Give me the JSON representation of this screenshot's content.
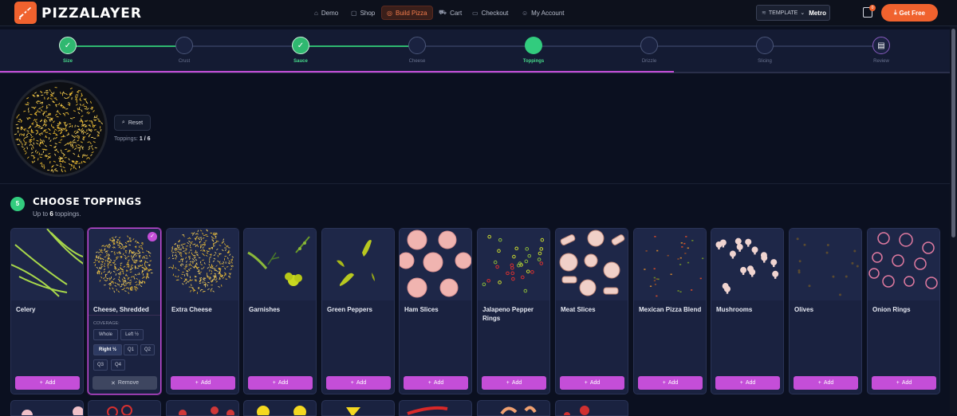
{
  "brand": {
    "name": "PIZZALAYER"
  },
  "nav": [
    {
      "label": "Demo",
      "icon": "home-icon"
    },
    {
      "label": "Shop",
      "icon": "bag-icon"
    },
    {
      "label": "Build Pizza",
      "icon": "target-icon",
      "active": true
    },
    {
      "label": "Cart",
      "icon": "cart-icon"
    },
    {
      "label": "Checkout",
      "icon": "card-icon"
    },
    {
      "label": "My Account",
      "icon": "user-icon"
    }
  ],
  "template": {
    "label": "TEMPLATE",
    "value": "Metro"
  },
  "cart_count": "0",
  "get_free": "Get Free",
  "steps": [
    {
      "label": "Size",
      "state": "done"
    },
    {
      "label": "Crust",
      "state": "todo"
    },
    {
      "label": "Sauce",
      "state": "done"
    },
    {
      "label": "Cheese",
      "state": "todo"
    },
    {
      "label": "Toppings",
      "state": "current"
    },
    {
      "label": "Drizzle",
      "state": "todo"
    },
    {
      "label": "Slicing",
      "state": "todo"
    },
    {
      "label": "Review",
      "state": "todo"
    }
  ],
  "preview": {
    "reset": "Reset",
    "count_label": "Toppings:",
    "count_value": "1 / 6"
  },
  "section": {
    "number": "5",
    "title": "CHOOSE TOPPINGS",
    "sub_prefix": "Up to",
    "sub_count": "6",
    "sub_suffix": "toppings."
  },
  "toppings": [
    {
      "name": "Celery"
    },
    {
      "name": "Cheese, Shredded",
      "selected": true
    },
    {
      "name": "Extra Cheese"
    },
    {
      "name": "Garnishes"
    },
    {
      "name": "Green Peppers"
    },
    {
      "name": "Ham Slices"
    },
    {
      "name": "Jalapeno Pepper Rings"
    },
    {
      "name": "Meat Slices"
    },
    {
      "name": "Mexican Pizza Blend"
    },
    {
      "name": "Mushrooms"
    },
    {
      "name": "Olives"
    },
    {
      "name": "Onion Rings"
    }
  ],
  "add_label": "Add",
  "coverage": {
    "label": "COVERAGE:",
    "options": [
      "Whole",
      "Left ½",
      "Right ½",
      "Q1",
      "Q2",
      "Q3",
      "Q4"
    ],
    "selected": "Right ½"
  },
  "remove_label": "Remove",
  "colors": {
    "accent": "#c44ed8",
    "brand": "#f0622e",
    "success": "#32cc7e"
  }
}
